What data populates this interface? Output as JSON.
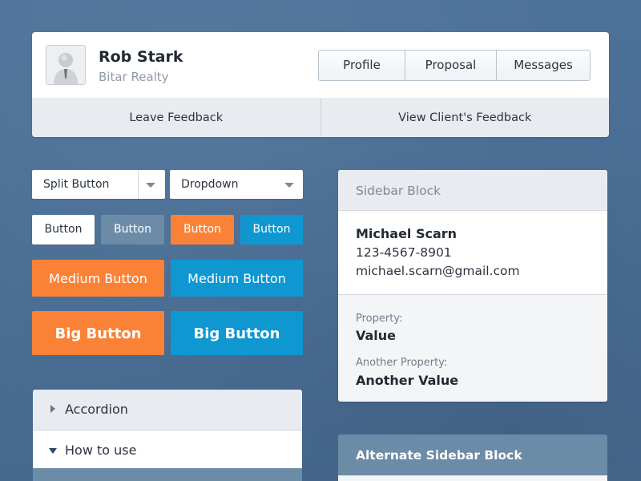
{
  "profile": {
    "name": "Rob Stark",
    "company": "Bitar Realty",
    "tabs": [
      "Profile",
      "Proposal",
      "Messages"
    ],
    "actions": {
      "leave_feedback": "Leave Feedback",
      "view_client_feedback": "View Client's Feedback"
    }
  },
  "controls": {
    "split_button": "Split Button",
    "dropdown": "Dropdown",
    "small_buttons": [
      "Button",
      "Button",
      "Button",
      "Button"
    ],
    "medium_buttons": [
      "Medium Button",
      "Medium Button"
    ],
    "big_buttons": [
      "Big Button",
      "Big Button"
    ]
  },
  "accordion": {
    "items": [
      {
        "label": "Accordion",
        "state": "collapsed"
      },
      {
        "label": "How to use",
        "state": "expanded"
      }
    ]
  },
  "sidebar": {
    "title": "Sidebar Block",
    "contact": {
      "name": "Michael Scarn",
      "phone": "123-4567-8901",
      "email": "michael.scarn@gmail.com"
    },
    "properties": [
      {
        "label": "Property:",
        "value": "Value"
      },
      {
        "label": "Another Property:",
        "value": "Another Value"
      }
    ]
  },
  "alt_sidebar": {
    "title": "Alternate Sidebar Block"
  },
  "colors": {
    "background": "#4a6f98",
    "orange": "#fa8237",
    "blue": "#0f97d2",
    "slate": "#6c8ba7",
    "panel_gray": "#e8ebf0"
  },
  "icons": {
    "avatar": "user-avatar-icon",
    "split_caret": "chevron-down-icon",
    "dropdown_caret": "chevron-down-icon",
    "accordion_collapsed": "triangle-right-icon",
    "accordion_expanded": "triangle-down-icon"
  }
}
